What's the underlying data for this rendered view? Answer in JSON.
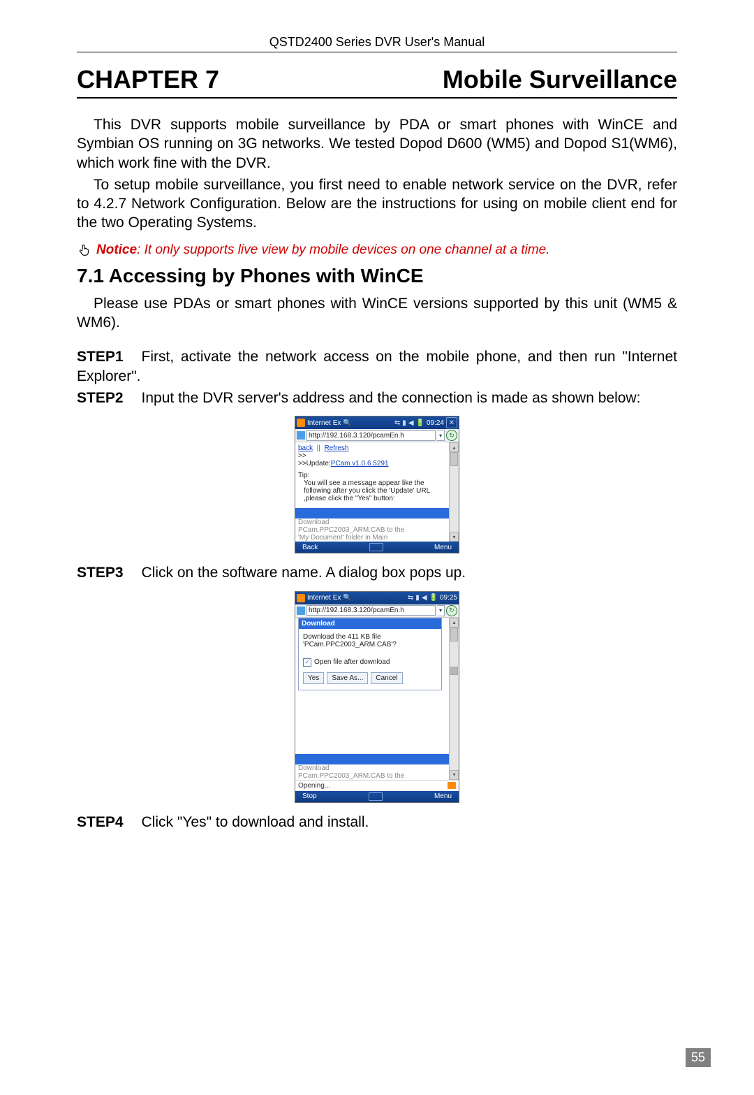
{
  "runningHeader": "QSTD2400 Series DVR User's Manual",
  "chapter": {
    "num": "CHAPTER 7",
    "title": "Mobile Surveillance"
  },
  "intro1": "This DVR supports mobile surveillance by PDA or smart phones with WinCE and Symbian OS running on 3G networks. We tested Dopod D600 (WM5) and Dopod S1(WM6), which work fine with the DVR.",
  "intro2": "To setup mobile surveillance, you first need to enable network service on the DVR, refer to 4.2.7 Network Configuration. Below are the instructions for using on mobile client end for the two Operating Systems.",
  "noticeLabel": "Notice",
  "noticeText": ": It only supports live view by mobile devices on one channel at a time.",
  "sectionHead": "7.1  Accessing by Phones with WinCE",
  "sectionIntro": "Please use PDAs or smart phones with WinCE versions supported by this unit (WM5 & WM6).",
  "steps": {
    "s1l": "STEP1",
    "s1t": "First, activate the network access on the mobile phone, and then run \"Internet Explorer\".",
    "s2l": "STEP2",
    "s2t": "Input the DVR server's address and the connection is made as shown below:",
    "s3l": "STEP3",
    "s3t": "Click on the software name. A dialog box pops up.",
    "s4l": "STEP4",
    "s4t": "Click \"Yes\" to download and install."
  },
  "shot1": {
    "title": "Internet Ex",
    "time": "09:24",
    "url": "http://192.168.3.120/pcamEn.h",
    "backLink": "back",
    "refreshLink": "Refresh",
    "arrows": ">>",
    "updatePrefix": ">>Update:",
    "updateLink": "PCam.v1.0.6.5291",
    "tipLabel": "Tip:",
    "tipBody": "You will see a message appear like the following after you click the 'Update' URL ,please click the \"Yes\" button:",
    "dlLabel": "Download",
    "dlLine1": "PCam.PPC2003_ARM.CAB to the",
    "dlLine2": "'My Document' folder in Main",
    "footBack": "Back",
    "footMenu": "Menu"
  },
  "shot2": {
    "title": "Internet Ex",
    "time": "09:25",
    "url": "http://192.168.3.120/pcamEn.h",
    "dlgTitle": "Download",
    "dlgLine1": "Download the 411 KB file",
    "dlgLine2": "'PCam.PPC2003_ARM.CAB'?",
    "chkLabel": "Open file after download",
    "btnYes": "Yes",
    "btnSaveAs": "Save As...",
    "btnCancel": "Cancel",
    "dlLabel": "Download",
    "dlLine1": "PCam.PPC2003_ARM.CAB to the",
    "status": "Opening...",
    "footStop": "Stop",
    "footMenu": "Menu"
  },
  "pageNum": "55"
}
